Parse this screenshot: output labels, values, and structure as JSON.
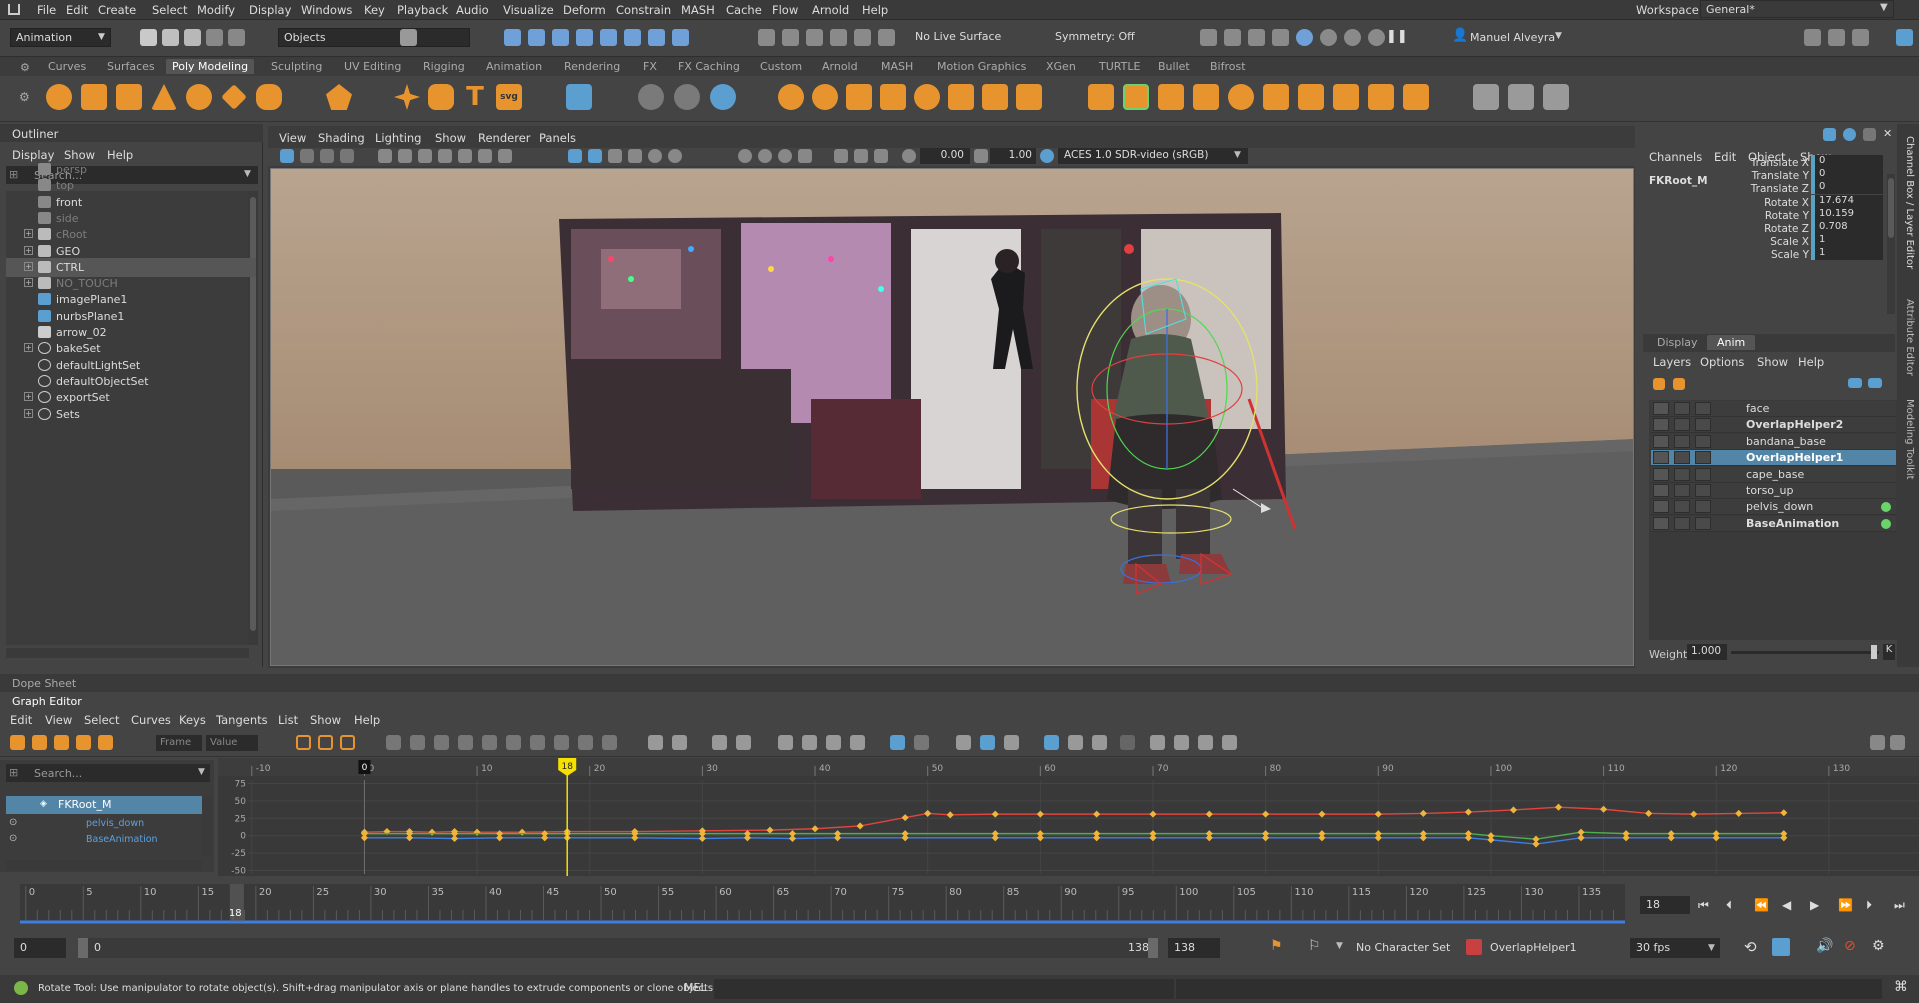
{
  "menubar": {
    "items": [
      "File",
      "Edit",
      "Create",
      "Select",
      "Modify",
      "Display",
      "Windows",
      "Key",
      "Playback",
      "Audio",
      "Visualize",
      "Deform",
      "Constrain",
      "MASH",
      "Cache",
      "Flow",
      "Arnold",
      "Help"
    ],
    "workspace_label": "Workspace:",
    "workspace_value": "General*"
  },
  "statusline": {
    "mode": "Animation",
    "selection_mode": "Objects",
    "live_surface": "No Live Surface",
    "symmetry": "Symmetry: Off",
    "user": "Manuel Alveyra"
  },
  "shelf": {
    "tabs": [
      "Curves",
      "Surfaces",
      "Poly Modeling",
      "Sculpting",
      "UV Editing",
      "Rigging",
      "Animation",
      "Rendering",
      "FX",
      "FX Caching",
      "Custom",
      "Arnold",
      "MASH",
      "Motion Graphics",
      "XGen",
      "TURTLE",
      "Bullet",
      "Bifrost"
    ],
    "active_tab": "Poly Modeling"
  },
  "outliner": {
    "title": "Outliner",
    "menu": [
      "Display",
      "Show",
      "Help"
    ],
    "search_placeholder": "Search...",
    "items": [
      {
        "label": "persp",
        "dim": true,
        "expand": false,
        "icon": "camera-icon"
      },
      {
        "label": "top",
        "dim": true,
        "expand": false,
        "icon": "camera-icon"
      },
      {
        "label": "front",
        "dim": false,
        "expand": false,
        "icon": "camera-icon"
      },
      {
        "label": "side",
        "dim": true,
        "expand": false,
        "icon": "camera-icon"
      },
      {
        "label": "cRoot",
        "dim": true,
        "expand": true,
        "icon": "transform-icon"
      },
      {
        "label": "GEO",
        "dim": false,
        "expand": true,
        "icon": "transform-icon"
      },
      {
        "label": "CTRL",
        "dim": false,
        "expand": true,
        "icon": "transform-icon",
        "selected": true
      },
      {
        "label": "NO_TOUCH",
        "dim": true,
        "expand": true,
        "icon": "transform-icon"
      },
      {
        "label": "imagePlane1",
        "dim": false,
        "expand": false,
        "icon": "image-plane-icon"
      },
      {
        "label": "nurbsPlane1",
        "dim": false,
        "expand": false,
        "icon": "nurbs-icon"
      },
      {
        "label": "arrow_02",
        "dim": false,
        "expand": false,
        "icon": "arrow-icon"
      },
      {
        "label": "bakeSet",
        "dim": false,
        "expand": true,
        "icon": "set-icon"
      },
      {
        "label": "defaultLightSet",
        "dim": false,
        "expand": false,
        "icon": "set-icon"
      },
      {
        "label": "defaultObjectSet",
        "dim": false,
        "expand": false,
        "icon": "set-icon"
      },
      {
        "label": "exportSet",
        "dim": false,
        "expand": true,
        "icon": "set-icon"
      },
      {
        "label": "Sets",
        "dim": false,
        "expand": true,
        "icon": "set-icon"
      }
    ]
  },
  "viewport": {
    "menu": [
      "View",
      "Shading",
      "Lighting",
      "Show",
      "Renderer",
      "Panels"
    ],
    "field_a": "0.00",
    "field_b": "1.00",
    "color_space": "ACES 1.0 SDR-video (sRGB)"
  },
  "channelbox": {
    "menu": [
      "Channels",
      "Edit",
      "Object",
      "Show"
    ],
    "object": "FKRoot_M",
    "channels": [
      {
        "name": "Translate X",
        "value": "0"
      },
      {
        "name": "Translate Y",
        "value": "0"
      },
      {
        "name": "Translate Z",
        "value": "0"
      },
      {
        "name": "Rotate X",
        "value": "17.674"
      },
      {
        "name": "Rotate Y",
        "value": "10.159"
      },
      {
        "name": "Rotate Z",
        "value": "0.708"
      },
      {
        "name": "Scale X",
        "value": "1"
      },
      {
        "name": "Scale Y",
        "value": "1"
      }
    ],
    "vertical_tabs": [
      "Channel Box / Layer Editor",
      "Attribute Editor",
      "Modeling Toolkit"
    ]
  },
  "layers": {
    "tabs": [
      "Display",
      "Anim"
    ],
    "active_tab": "Anim",
    "menu": [
      "Layers",
      "Options",
      "Show",
      "Help"
    ],
    "items": [
      {
        "name": "face",
        "bold": false,
        "selected": false,
        "dot": false
      },
      {
        "name": "OverlapHelper2",
        "bold": true,
        "selected": false,
        "dot": false
      },
      {
        "name": "bandana_base",
        "bold": false,
        "selected": false,
        "dot": false
      },
      {
        "name": "OverlapHelper1",
        "bold": true,
        "selected": true,
        "dot": false
      },
      {
        "name": "cape_base",
        "bold": false,
        "selected": false,
        "dot": false
      },
      {
        "name": "torso_up",
        "bold": false,
        "selected": false,
        "dot": false
      },
      {
        "name": "pelvis_down",
        "bold": false,
        "selected": false,
        "dot": true
      },
      {
        "name": "BaseAnimation",
        "bold": true,
        "selected": false,
        "dot": true
      }
    ],
    "weight_label": "Weight",
    "weight_value": "1.000",
    "k_label": "K"
  },
  "graph_editor": {
    "dope_sheet_tab": "Dope Sheet",
    "graph_editor_tab": "Graph Editor",
    "menu": [
      "Edit",
      "View",
      "Select",
      "Curves",
      "Keys",
      "Tangents",
      "List",
      "Show",
      "Help"
    ],
    "frame_placeholder": "Frame",
    "value_placeholder": "Value",
    "search_placeholder": "Search...",
    "nodes": [
      {
        "label": "FKRoot_M",
        "selected": true
      },
      {
        "label": "pelvis_down",
        "selected": false
      },
      {
        "label": "BaseAnimation",
        "selected": false
      }
    ],
    "x_ticks": [
      "-10",
      "0",
      "10",
      "20",
      "30",
      "40",
      "50",
      "60",
      "70",
      "80",
      "90",
      "100",
      "110",
      "120",
      "130"
    ],
    "y_ticks": [
      "75",
      "50",
      "25",
      "0",
      "-25",
      "-50"
    ],
    "current_frame_marker": "18",
    "start_marker": "0"
  },
  "chart_data": {
    "type": "line",
    "xlabel": "",
    "ylabel": "",
    "xlim": [
      -10,
      135
    ],
    "ylim": [
      -55,
      80
    ],
    "series": [
      {
        "color": "#e0463c",
        "x": [
          0,
          2,
          4,
          6,
          8,
          10,
          14,
          18,
          24,
          30,
          36,
          40,
          44,
          48,
          50,
          52,
          56,
          60,
          65,
          70,
          75,
          80,
          85,
          90,
          94,
          98,
          102,
          106,
          110,
          114,
          118,
          122,
          126
        ],
        "values": [
          5,
          6,
          6,
          5,
          6,
          5,
          5,
          6,
          6,
          7,
          8,
          10,
          14,
          26,
          32,
          30,
          31,
          31,
          31,
          31,
          31,
          31,
          31,
          31,
          32,
          34,
          37,
          41,
          38,
          32,
          31,
          32,
          33
        ]
      },
      {
        "color": "#4caf50",
        "x": [
          0,
          4,
          8,
          12,
          16,
          18,
          24,
          30,
          34,
          38,
          42,
          48,
          56,
          60,
          65,
          70,
          75,
          80,
          85,
          90,
          94,
          98,
          100,
          104,
          108,
          112,
          116,
          120,
          126
        ],
        "values": [
          3,
          3,
          3,
          3,
          3,
          3,
          3,
          3,
          3,
          3,
          3,
          3,
          3,
          3,
          3,
          3,
          3,
          3,
          3,
          3,
          3,
          3,
          0,
          -5,
          5,
          3,
          3,
          3,
          3
        ]
      },
      {
        "color": "#3d7ee0",
        "x": [
          0,
          4,
          8,
          12,
          16,
          18,
          24,
          30,
          34,
          38,
          42,
          48,
          56,
          60,
          65,
          70,
          75,
          80,
          85,
          90,
          94,
          98,
          100,
          104,
          108,
          112,
          116,
          120,
          126
        ],
        "values": [
          -3,
          -3,
          -4,
          -3,
          -3,
          -3,
          -3,
          -4,
          -3,
          -4,
          -3,
          -3,
          -3,
          -3,
          -3,
          -3,
          -3,
          -3,
          -3,
          -3,
          -3,
          -3,
          -6,
          -12,
          -3,
          -3,
          -3,
          -3,
          -3
        ]
      }
    ]
  },
  "timeline": {
    "ticks": [
      "0",
      "5",
      "10",
      "15",
      "20",
      "25",
      "30",
      "35",
      "40",
      "45",
      "50",
      "55",
      "60",
      "65",
      "70",
      "75",
      "80",
      "85",
      "90",
      "95",
      "100",
      "105",
      "110",
      "115",
      "120",
      "125",
      "130",
      "135"
    ],
    "current_frame": "18",
    "current_frame_field": "18",
    "range_start": "0",
    "range_inner_start": "0",
    "range_inner_end": "138",
    "range_end": "138",
    "character_set": "No Character Set",
    "anim_layer": "OverlapHelper1",
    "fps": "30 fps"
  },
  "helpline": {
    "text": "Rotate Tool: Use manipulator to rotate object(s). Shift+drag manipulator axis or plane handles to extrude components or clone objects. Ctrl+Shi",
    "mel_label": "MEL"
  }
}
